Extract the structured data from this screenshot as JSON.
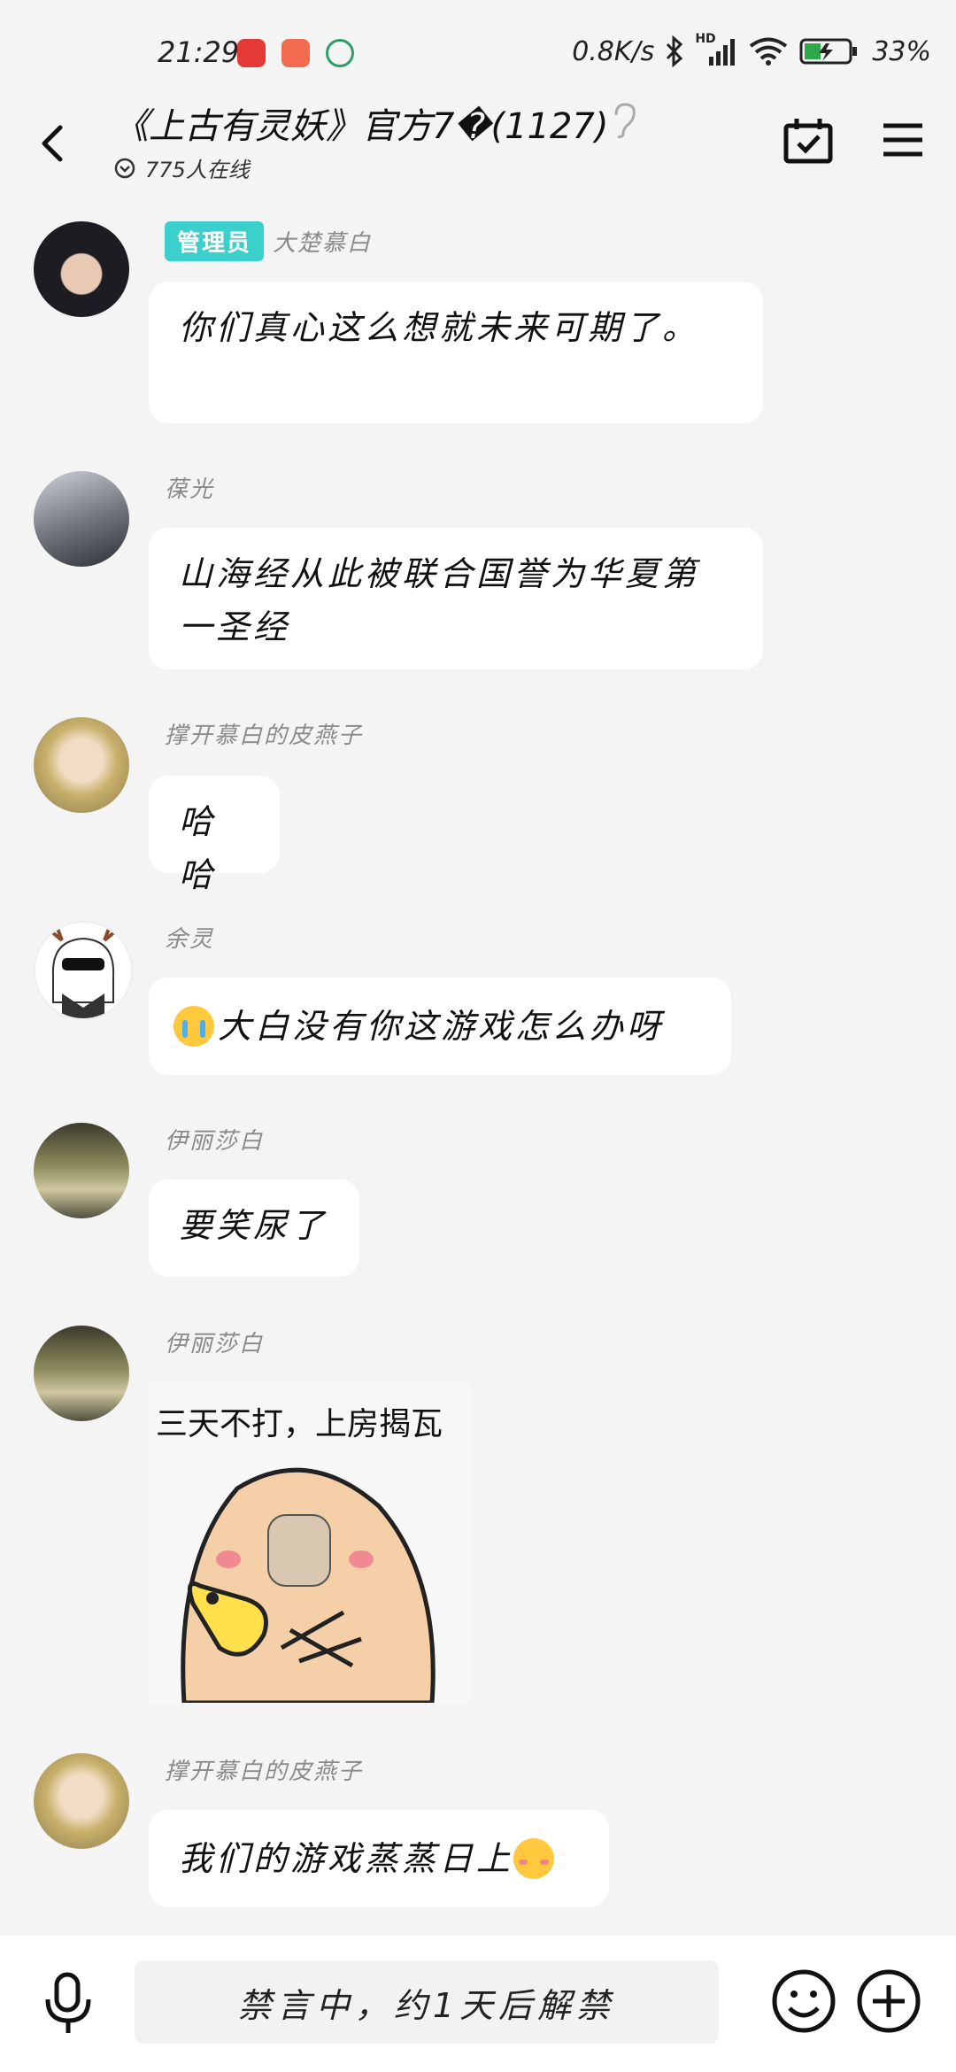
{
  "status_bar": {
    "time": "21:29",
    "speed": "0.8K/s",
    "battery": "33%",
    "hd_label": "HD"
  },
  "header": {
    "title": "《上古有灵妖》官方7�(1127)",
    "online": "775人在线"
  },
  "messages": [
    {
      "badge": "管理员",
      "name": "大楚慕白",
      "text": "你们真心这么想就未来可期了。"
    },
    {
      "name": "葆光",
      "text": "山海经从此被联合国誉为华夏第一圣经"
    },
    {
      "name": "撑开慕白的皮燕子",
      "text": "哈哈"
    },
    {
      "name": "余灵",
      "text": "大白没有你这游戏怎么办呀"
    },
    {
      "name": "伊丽莎白",
      "text": "要笑尿了"
    },
    {
      "name": "伊丽莎白",
      "sticker_caption": "三天不打，上房揭瓦"
    },
    {
      "name": "撑开慕白的皮燕子",
      "text": "我们的游戏蒸蒸日上"
    }
  ],
  "input_bar": {
    "placeholder": "禁言中，约1天后解禁"
  },
  "colors": {
    "badge": "#3cd0cc",
    "bubble": "#ffffff",
    "background": "#f4f4f4"
  }
}
